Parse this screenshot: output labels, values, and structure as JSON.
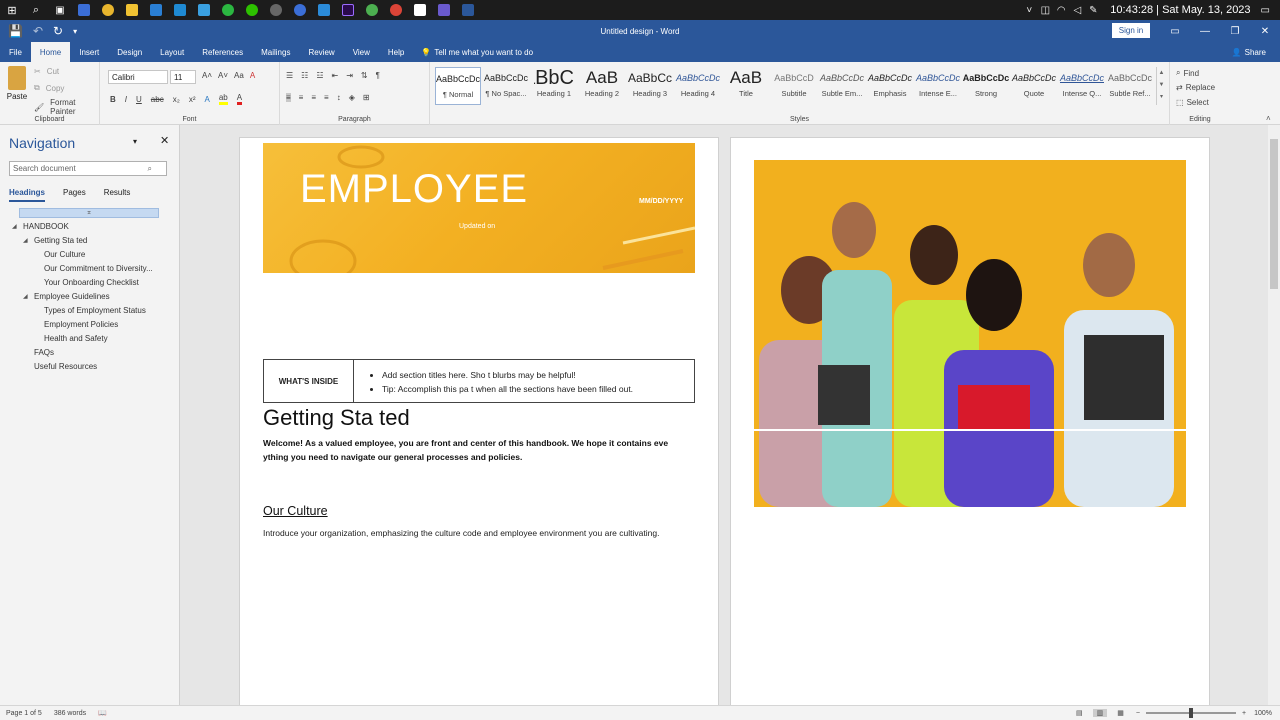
{
  "taskbar": {
    "clock": "10:43:28 | Sat May. 13, 2023",
    "apps": [
      "start-icon",
      "search-icon",
      "task-view-icon",
      "app-icon",
      "chrome-icon",
      "file-explorer-icon",
      "app-icon",
      "vscode-icon",
      "app-icon",
      "whatsapp-icon",
      "wechat-icon",
      "app-icon",
      "app-icon",
      "photos-icon",
      "premiere-icon",
      "app-icon",
      "chrome-icon",
      "app-icon",
      "app-icon",
      "word-icon"
    ]
  },
  "titlebar": {
    "title": "Untitled design - Word",
    "signin": "Sign in"
  },
  "ribbon_tabs": {
    "file": "File",
    "home": "Home",
    "insert": "Insert",
    "design": "Design",
    "layout": "Layout",
    "references": "References",
    "mailings": "Mailings",
    "review": "Review",
    "view": "View",
    "help": "Help",
    "tellme": "Tell me what you want to do",
    "share": "Share"
  },
  "clipboard": {
    "paste": "Paste",
    "cut": "Cut",
    "copy": "Copy",
    "format_painter": "Format Painter",
    "label": "Clipboard"
  },
  "font": {
    "name": "Calibri",
    "size": "11",
    "label": "Font",
    "bold": "B",
    "italic": "I",
    "underline": "U",
    "strike": "abc",
    "sub": "x₂",
    "sup": "x²"
  },
  "paragraph": {
    "label": "Paragraph"
  },
  "styles": {
    "label": "Styles",
    "items": [
      {
        "sample": "AaBbCcDc",
        "name": "¶ Normal"
      },
      {
        "sample": "AaBbCcDc",
        "name": "¶ No Spac..."
      },
      {
        "sample": "AaBbC",
        "name": "Heading 1"
      },
      {
        "sample": "AaB",
        "name": "Heading 2"
      },
      {
        "sample": "AaBbCc",
        "name": "Heading 3"
      },
      {
        "sample": "AaBbCcDc",
        "name": "Heading 4"
      },
      {
        "sample": "AaB",
        "name": "Title"
      },
      {
        "sample": "AaBbCcD",
        "name": "Subtitle"
      },
      {
        "sample": "AaBbCcDc",
        "name": "Subtle Em..."
      },
      {
        "sample": "AaBbCcDc",
        "name": "Emphasis"
      },
      {
        "sample": "AaBbCcDc",
        "name": "Intense E..."
      },
      {
        "sample": "AaBbCcDc",
        "name": "Strong"
      },
      {
        "sample": "AaBbCcDc",
        "name": "Quote"
      },
      {
        "sample": "AaBbCcDc",
        "name": "Intense Q..."
      },
      {
        "sample": "AaBbCcDc",
        "name": "Subtle Ref..."
      }
    ]
  },
  "editing": {
    "find": "Find",
    "replace": "Replace",
    "select": "Select",
    "label": "Editing"
  },
  "navigation": {
    "title": "Navigation",
    "search_placeholder": "Search document",
    "tabs": [
      "Headings",
      "Pages",
      "Results"
    ],
    "items": [
      {
        "label": "HANDBOOK"
      },
      {
        "label": "Getting Sta ted"
      },
      {
        "label": "Our Culture"
      },
      {
        "label": "Our Commitment to Diversity..."
      },
      {
        "label": "Your Onboarding Checklist"
      },
      {
        "label": "Employee Guidelines"
      },
      {
        "label": "Types of Employment Status"
      },
      {
        "label": "Employment Policies"
      },
      {
        "label": "Health and Safety"
      },
      {
        "label": "FAQs"
      },
      {
        "label": "Useful Resources"
      }
    ]
  },
  "document": {
    "banner_title": "EMPLOYEE",
    "banner_date": "MM/DD/YYYY",
    "banner_updated": "Updated on",
    "whats_inside": "WHAT'S INSIDE",
    "inside_items": [
      "Add section titles here. Sho t blurbs may be helpful!",
      "Tip: Accomplish this pa t when all the sections have been filled out."
    ],
    "heading1": "Getting Sta ted",
    "welcome": "Welcome! As a valued employee, you are front and center of this handbook. We hope it contains eve ything you need to navigate our general processes and policies.",
    "heading2": "Our Culture",
    "culture_text": "Introduce your organization, emphasizing the culture code and employee environment you are cultivating."
  },
  "status": {
    "page": "Page 1 of 5",
    "words": "386 words",
    "zoom": "100%"
  }
}
